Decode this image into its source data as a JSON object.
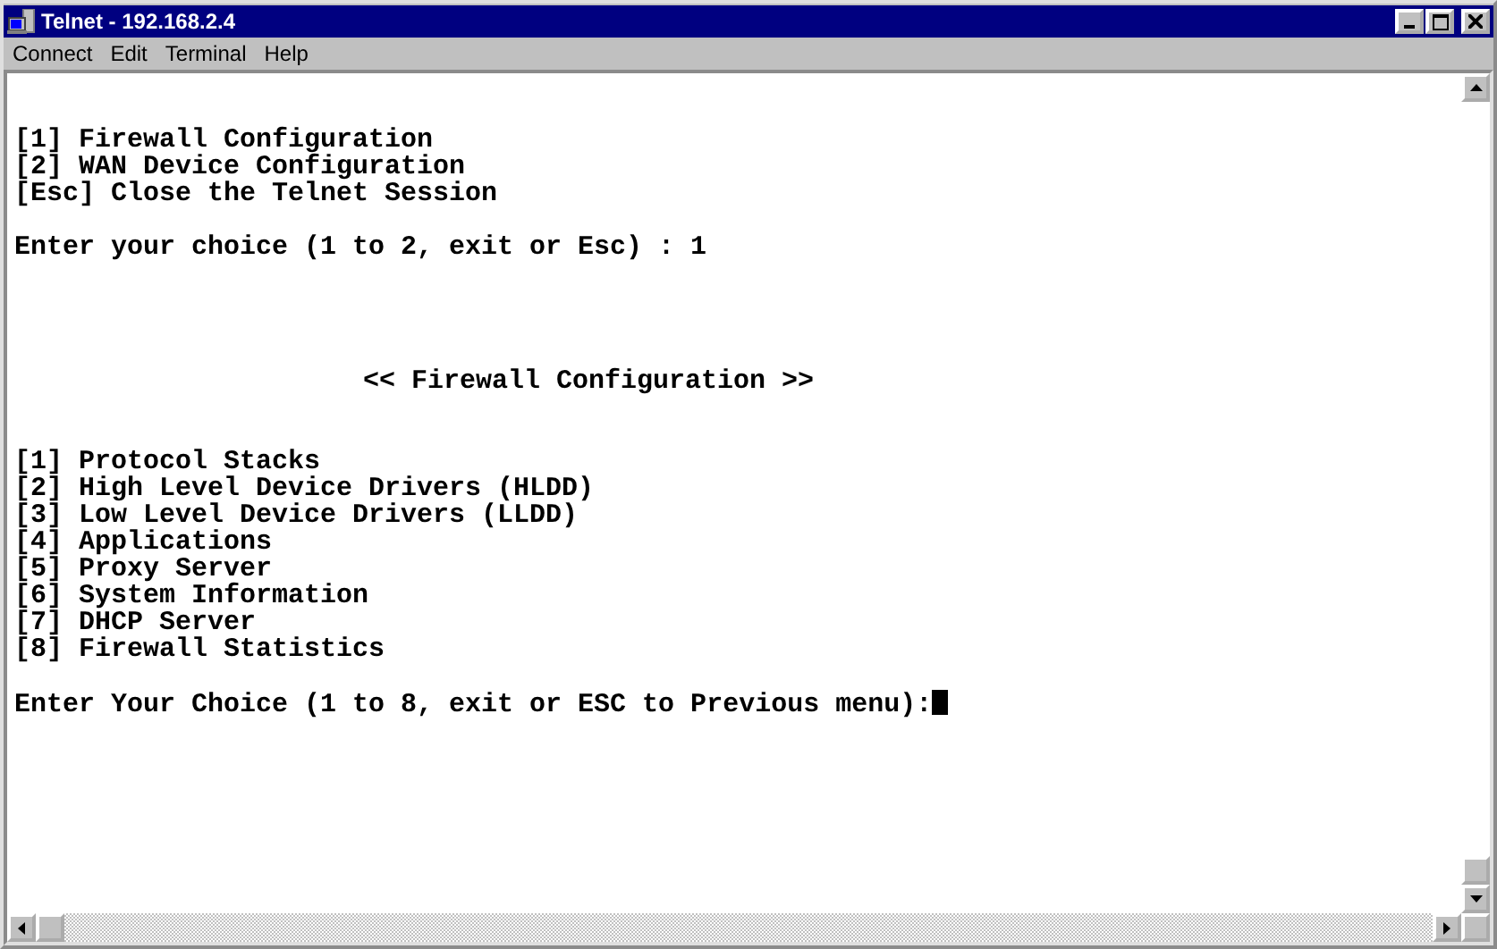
{
  "window": {
    "title": "Telnet - 192.168.2.4"
  },
  "menu": [
    "Connect",
    "Edit",
    "Terminal",
    "Help"
  ],
  "terminal": {
    "blocks": [
      {
        "kind": "menu",
        "lines": [
          "[1] Firewall Configuration",
          "[2] WAN Device Configuration",
          "[Esc] Close the Telnet Session"
        ]
      },
      {
        "kind": "answer",
        "lines": [
          "Enter your choice (1 to 2, exit or Esc) : 1"
        ]
      },
      {
        "kind": "heading",
        "lines": [
          "<< Firewall Configuration >>"
        ]
      },
      {
        "kind": "options",
        "lines": [
          "[1] Protocol Stacks",
          "[2] High Level Device Drivers (HLDD)",
          "[3] Low Level Device Drivers (LLDD)",
          "[4] Applications",
          "[5] Proxy Server",
          "[6] System Information",
          "[7] DHCP Server",
          "[8] Firewall Statistics"
        ]
      },
      {
        "kind": "prompt",
        "lines": [
          "Enter Your Choice (1 to 8, exit or ESC to Previous menu):"
        ]
      }
    ]
  }
}
